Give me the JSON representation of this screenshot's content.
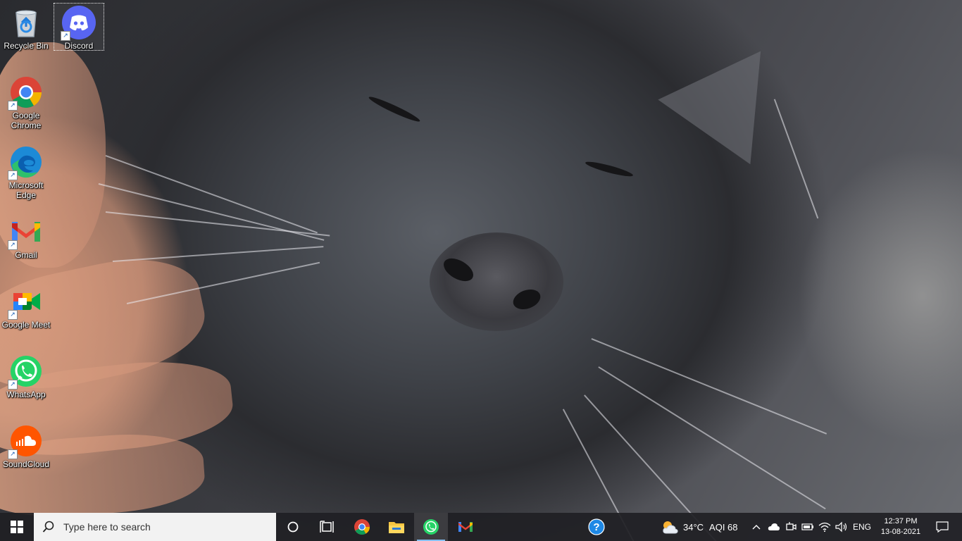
{
  "desktop": {
    "icons": [
      {
        "label": "Recycle Bin",
        "icon": "recycle-bin-icon"
      },
      {
        "label": "Discord",
        "icon": "discord-icon"
      },
      {
        "label": "Google Chrome",
        "icon": "chrome-icon"
      },
      {
        "label": "Microsoft Edge",
        "icon": "edge-icon"
      },
      {
        "label": "Gmail",
        "icon": "gmail-icon"
      },
      {
        "label": "Google Meet",
        "icon": "google-meet-icon"
      },
      {
        "label": "WhatsApp",
        "icon": "whatsapp-icon"
      },
      {
        "label": "SoundCloud",
        "icon": "soundcloud-icon"
      }
    ],
    "selected_icon": "Discord"
  },
  "taskbar": {
    "search_placeholder": "Type here to search",
    "pinned": [
      "start-icon",
      "cortana-icon",
      "task-view-icon",
      "chrome-icon",
      "file-explorer-icon",
      "whatsapp-icon",
      "gmail-icon",
      "help-icon"
    ],
    "active_app": "WhatsApp",
    "weather": {
      "temp": "34°C",
      "aqi": "AQI 68",
      "icon": "partly-cloudy-icon"
    },
    "tray_icons": [
      "chevron-up-icon",
      "onedrive-icon",
      "meet-now-icon",
      "battery-icon",
      "wifi-icon",
      "volume-icon"
    ],
    "language": "ENG",
    "time": "12:37 PM",
    "date": "13-08-2021"
  },
  "colors": {
    "taskbar_bg": "#202024",
    "active_indicator": "#86c0f2",
    "discord": "#5865f2",
    "whatsapp": "#25d366",
    "soundcloud": "#ff5500"
  }
}
